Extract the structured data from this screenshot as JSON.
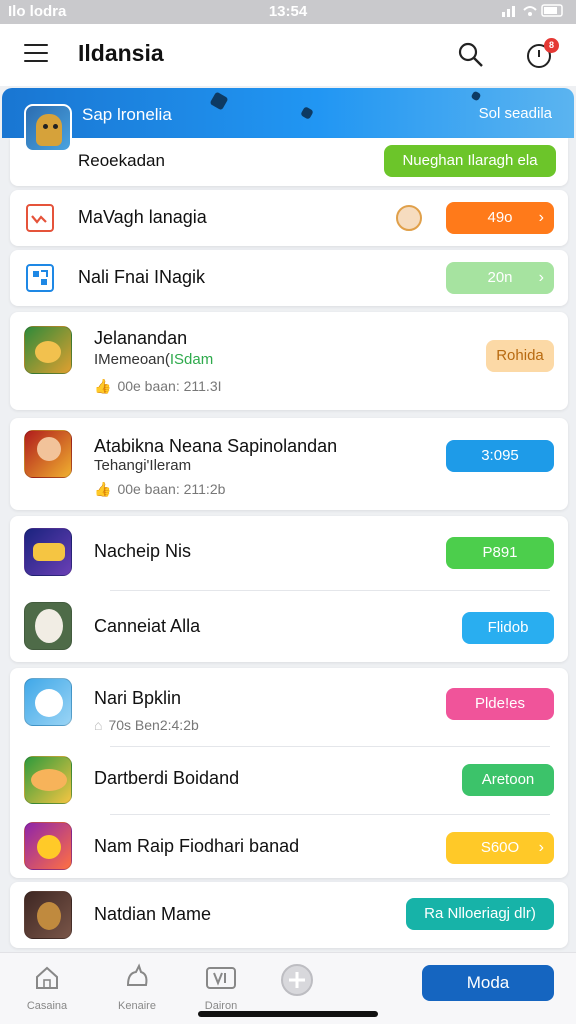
{
  "status_bar": {
    "carrier": "Ilo lodra",
    "time": "13:54"
  },
  "app_bar": {
    "title": "Ildansia"
  },
  "notifications": {
    "count": "8"
  },
  "banner": {
    "title": "Sap lronelia",
    "right_text": "Sol seadila",
    "subtitle": "Reoekadan",
    "action_label": "Nueghan Ilaragh ela"
  },
  "quick_rows": [
    {
      "label": "MaVagh lanagia",
      "action_label": "49o",
      "color": "#ff7a1a"
    },
    {
      "label": "Nali Fnai INagik",
      "action_label": "20n",
      "color": "#a6e3a0"
    }
  ],
  "apps": [
    {
      "name": "Jelanandan",
      "subtitle": "IMemeoan(",
      "tag": "ISdam",
      "meta": "00e baan: 211.3I",
      "action_label": "Rohida",
      "action_color": "#fcd9a6",
      "action_text_color": "#b86a10"
    },
    {
      "name": "Atabikna Neana Sapinolandan",
      "subtitle": "Tehangi'Ileram",
      "meta": "00e baan: 211:2b",
      "action_label": "3:095",
      "action_color": "#1e9be8"
    },
    {
      "name": "Nacheip Nis",
      "action_label": "P891",
      "action_color": "#4cce4c"
    },
    {
      "name": "Canneiat Alla",
      "action_label": "Flidob",
      "action_color": "#29aef0"
    },
    {
      "name": "Nari Bpklin",
      "meta": "70s Ben2:4:2b",
      "action_label": "Plde!es",
      "action_color": "#f0549a"
    },
    {
      "name": "Dartberdi Boidand",
      "action_label": "Aretoon",
      "action_color": "#3cc36a"
    },
    {
      "name": "Nam Raip Fiodhari banad",
      "action_label": "S60O",
      "action_color": "#ffc928"
    },
    {
      "name": "Natdian Mame",
      "action_label": "Ra Nlloeriagj dlr)",
      "action_color": "#17b3a8"
    }
  ],
  "bottom_nav": [
    {
      "label": "Casaina",
      "icon": "home-icon"
    },
    {
      "label": "Kenaire",
      "icon": "cat-icon"
    },
    {
      "label": "Dairon",
      "icon": "media-icon"
    },
    {
      "label": "",
      "icon": "plus-icon"
    }
  ],
  "cta": {
    "label": "Moda"
  }
}
